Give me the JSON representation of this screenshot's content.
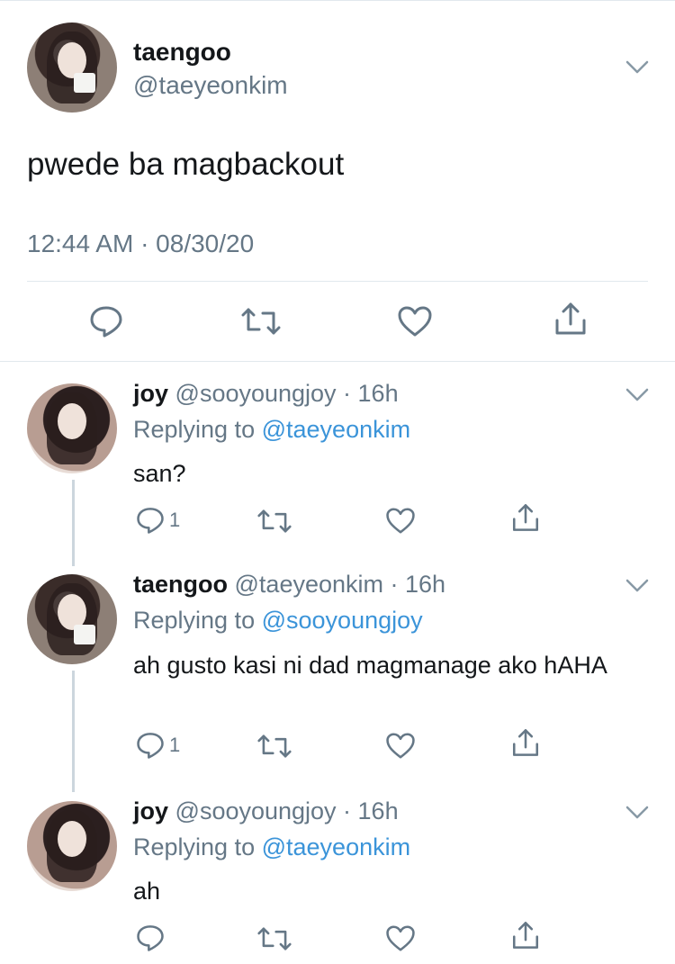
{
  "main_tweet": {
    "display_name": "taengoo",
    "handle": "@taeyeonkim",
    "text": "pwede ba magbackout",
    "timestamp": "12:44 AM · 08/30/20"
  },
  "replies": [
    {
      "display_name": "joy",
      "handle": "@sooyoungjoy · 16h",
      "replying_prefix": "Replying to",
      "replying_to": "@taeyeonkim",
      "text": "san?",
      "reply_count": "1"
    },
    {
      "display_name": "taengoo",
      "handle": "@taeyeonkim · 16h",
      "replying_prefix": "Replying to",
      "replying_to": "@sooyoungjoy",
      "text": "ah gusto kasi ni dad magmanage ako hAHA",
      "reply_count": "1"
    },
    {
      "display_name": "joy",
      "handle": "@sooyoungjoy · 16h",
      "replying_prefix": "Replying to",
      "replying_to": "@taeyeonkim",
      "text": "ah",
      "reply_count": ""
    }
  ],
  "icons": {
    "reply": "reply-icon",
    "retweet": "retweet-icon",
    "like": "heart-icon",
    "share": "share-icon",
    "menu": "chevron-down-icon"
  },
  "colors": {
    "text": "#14171a",
    "secondary": "#657786",
    "link": "#3b94d9",
    "divider": "#e1e8ed",
    "thread_line": "#ccd6dd"
  }
}
